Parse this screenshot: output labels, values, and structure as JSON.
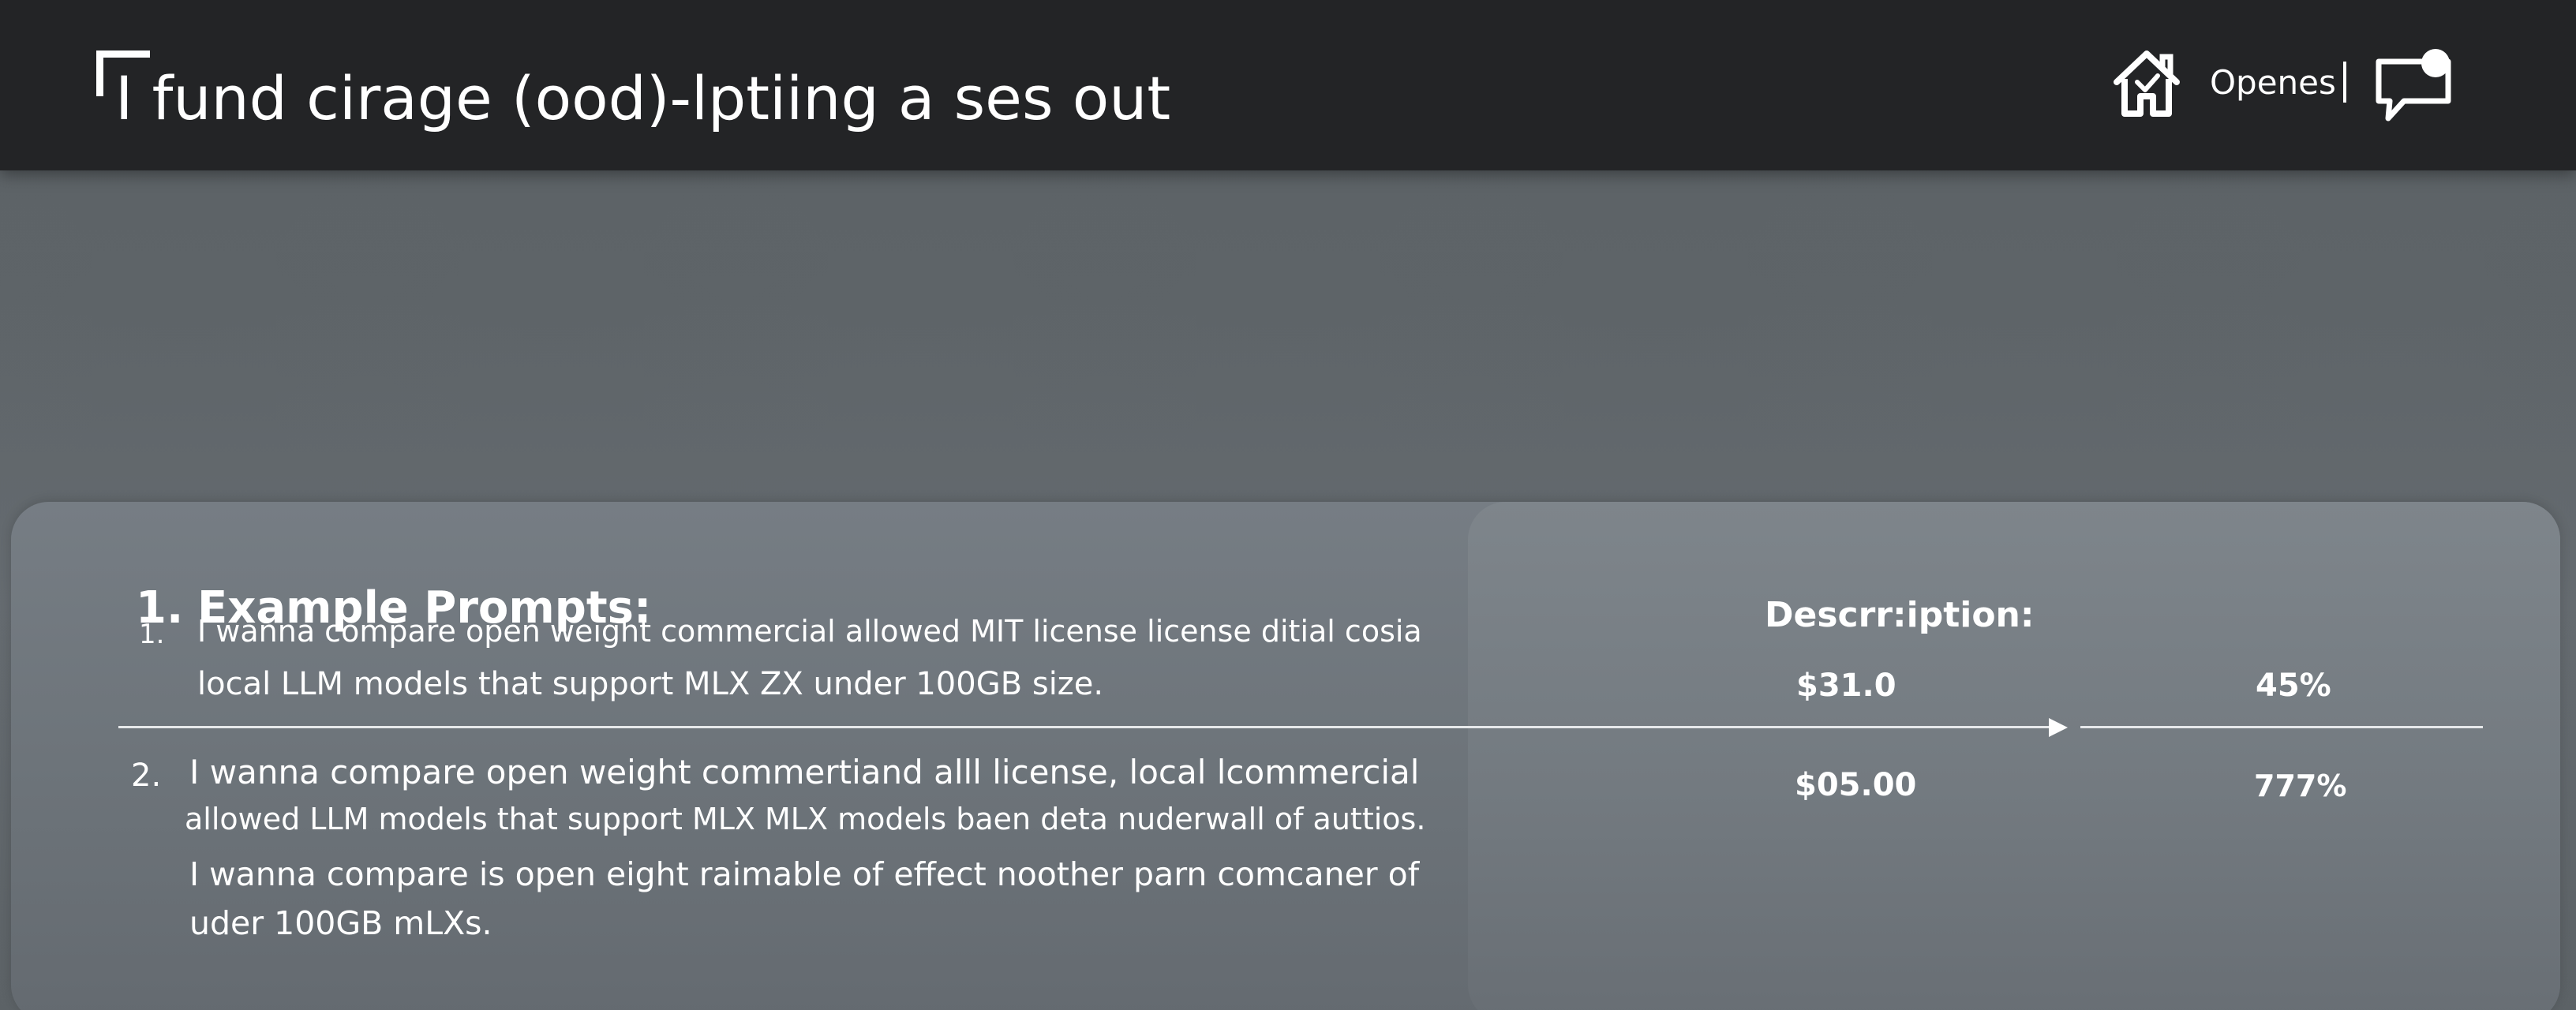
{
  "header": {
    "title": "I fund cirage (ood)-lptiing a ses out",
    "nav_label": "Openes",
    "icons": [
      "bracket-icon",
      "home-icon",
      "chat-icon"
    ]
  },
  "prompts": {
    "heading_number": "1.",
    "heading": "Example Prompts:",
    "items": [
      {
        "number": "1.",
        "lines": [
          "I wanna compare open weight commercial allowed MIT license license ditial cosia",
          "local LLM models that support MLX ZX under 100GB size."
        ]
      },
      {
        "number": "2.",
        "lines": [
          "I wanna compare open weight commertiand alll license, local lcommercial",
          "allowed LLM models that support MLX MLX models baen deta nuderwall of auttios.",
          "I wanna compare is open eight raimable of effect noother parn comcaner of",
          "uder 100GB mLXs."
        ]
      }
    ]
  },
  "description": {
    "title": "Descrr:iption:",
    "rows": [
      {
        "price": "$31.0",
        "percent": "45%"
      },
      {
        "price": "$05.00",
        "percent": "777%"
      }
    ]
  },
  "colors": {
    "header_bg": "#232426",
    "page_bg": "#5e6468",
    "panel_left": "#6d747a",
    "panel_right": "#787f85",
    "text": "#ffffff"
  }
}
